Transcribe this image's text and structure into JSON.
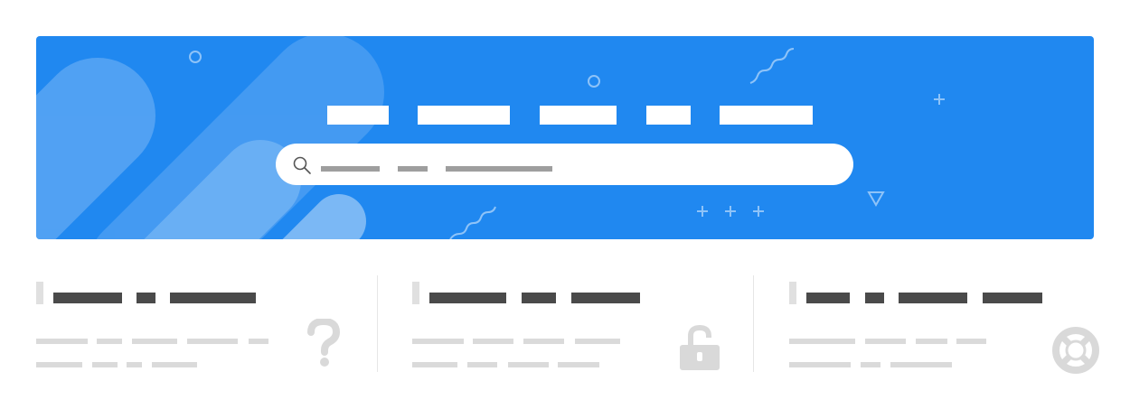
{
  "hero": {
    "background_color": "#2088f0",
    "title_redacted": true,
    "search": {
      "placeholder_redacted": true,
      "icon": "search-icon"
    },
    "decorations": [
      "circle-outline",
      "circle-outline",
      "squiggle",
      "squiggle",
      "plus",
      "plus",
      "plus",
      "plus",
      "triangle-outline"
    ]
  },
  "cards": [
    {
      "icon": "question-mark-icon",
      "title_redacted": true,
      "body_redacted": true
    },
    {
      "icon": "unlock-icon",
      "title_redacted": true,
      "body_redacted": true
    },
    {
      "icon": "lifebuoy-icon",
      "title_redacted": true,
      "body_redacted": true
    }
  ],
  "colors": {
    "accent": "#2088f0",
    "card_title": "#4a4a4a",
    "card_text": "#dadada",
    "icon_muted": "#d9d9d9"
  }
}
